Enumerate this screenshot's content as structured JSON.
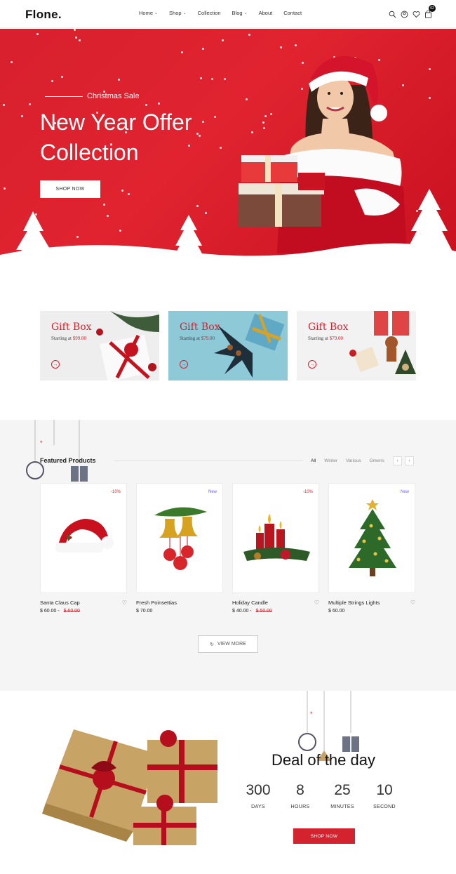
{
  "header": {
    "logo": "Flone.",
    "nav": [
      {
        "label": "Home",
        "has_dropdown": true
      },
      {
        "label": "Shop",
        "has_dropdown": true
      },
      {
        "label": "Collection",
        "has_dropdown": false
      },
      {
        "label": "Blog",
        "has_dropdown": true
      },
      {
        "label": "About",
        "has_dropdown": false
      },
      {
        "label": "Contact",
        "has_dropdown": false
      }
    ],
    "icons": [
      "search-icon",
      "account-icon",
      "heart-icon",
      "cart-icon"
    ],
    "cart_count": "02"
  },
  "hero": {
    "subtitle": "Christmas Sale",
    "title": "New Year Offer Collection",
    "button": "SHOP NOW",
    "bg_color": "#e0232f"
  },
  "banners": [
    {
      "title": "Gift Box",
      "starting_label": "Starting at",
      "price": "$99.00",
      "bg": "#eeeeee"
    },
    {
      "title": "Gift Box",
      "starting_label": "Starting at",
      "price": "$79.00",
      "bg": "#8ec9d8"
    },
    {
      "title": "Gift Box",
      "starting_label": "Starting at",
      "price": "$79.00",
      "bg": "#f2f2f2"
    }
  ],
  "featured": {
    "title": "Featured Products",
    "tabs": [
      "All",
      "Winter",
      "Various",
      "Greens"
    ],
    "active_tab": "All",
    "products": [
      {
        "name": "Santa Claus Cap",
        "price": "$ 60.00",
        "old_price": "$ 60.00",
        "badge": "-10%",
        "badge_type": "sale",
        "image": "santa-hat"
      },
      {
        "name": "Fresh Poinsettias",
        "price": "$ 70.00",
        "old_price": "",
        "badge": "New",
        "badge_type": "new",
        "image": "bells-ornament"
      },
      {
        "name": "Holiday Candle",
        "price": "$ 40.00",
        "old_price": "$ 50.00",
        "badge": "-10%",
        "badge_type": "sale",
        "image": "candles"
      },
      {
        "name": "Multiple Strings Lights",
        "price": "$ 60.00",
        "old_price": "",
        "badge": "New",
        "badge_type": "new",
        "image": "christmas-tree"
      }
    ],
    "view_more": "VIEW MORE"
  },
  "deal": {
    "title": "Deal of the day",
    "countdown": [
      {
        "value": "300",
        "label": "DAYS"
      },
      {
        "value": "8",
        "label": "HOURS"
      },
      {
        "value": "25",
        "label": "MINUTES"
      },
      {
        "value": "10",
        "label": "SECOND"
      }
    ],
    "button": "SHOP NOW"
  },
  "colors": {
    "accent": "#d2232f",
    "new_badge": "#6a5cff"
  }
}
